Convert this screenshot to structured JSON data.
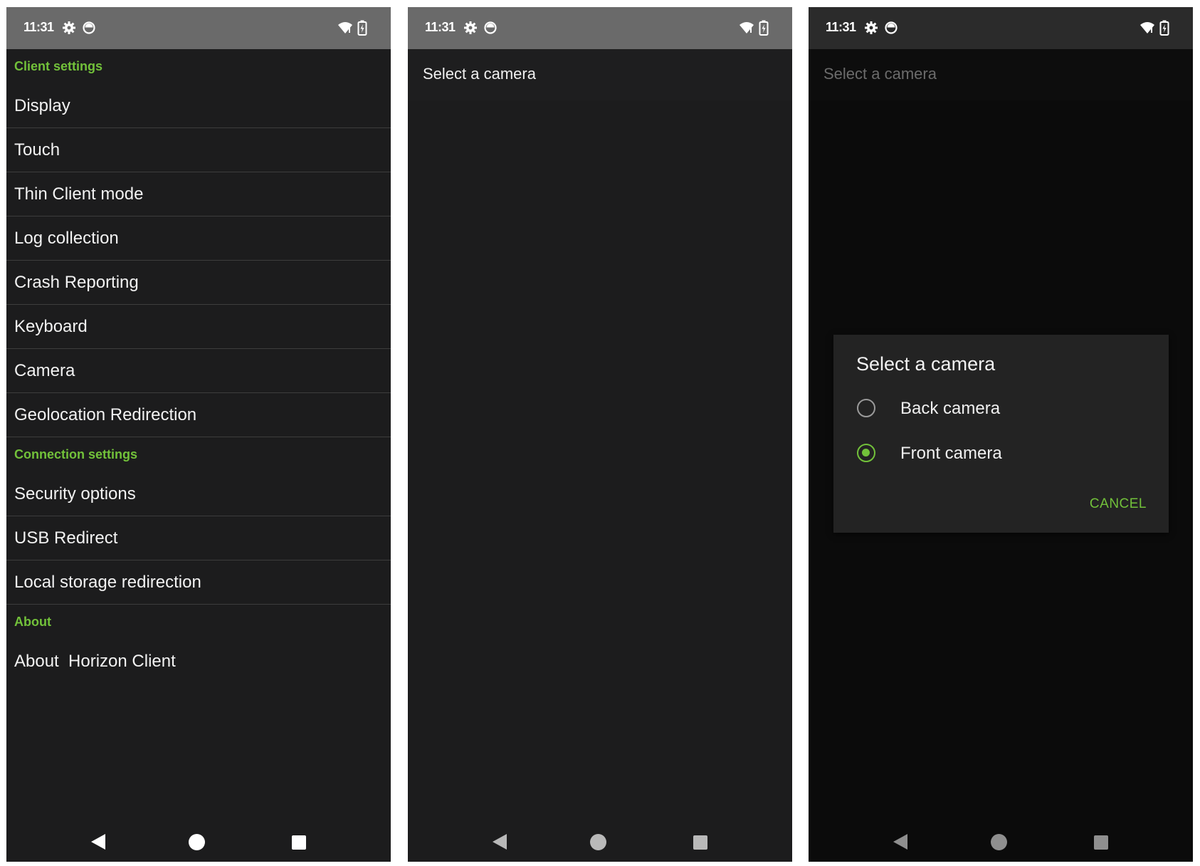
{
  "colors": {
    "accent": "#72c13a",
    "background": "#1c1c1d",
    "statusbar": "#6a6a6a",
    "dialog": "#232323"
  },
  "status": {
    "time": "11:31"
  },
  "screen1": {
    "sections": [
      {
        "header": "Client settings",
        "items": [
          "Display",
          "Touch",
          "Thin Client mode",
          "Log collection",
          "Crash Reporting",
          "Keyboard",
          "Camera",
          "Geolocation Redirection"
        ]
      },
      {
        "header": "Connection settings",
        "items": [
          "Security options",
          "USB Redirect",
          "Local storage redirection"
        ]
      },
      {
        "header": "About",
        "items": [
          "About  Horizon Client"
        ]
      }
    ]
  },
  "screen2": {
    "header": "Select a camera"
  },
  "screen3": {
    "header": "Select a camera",
    "dialog": {
      "title": "Select a camera",
      "options": [
        {
          "label": "Back camera",
          "selected": false
        },
        {
          "label": "Front camera",
          "selected": true
        }
      ],
      "cancel": "CANCEL"
    }
  }
}
